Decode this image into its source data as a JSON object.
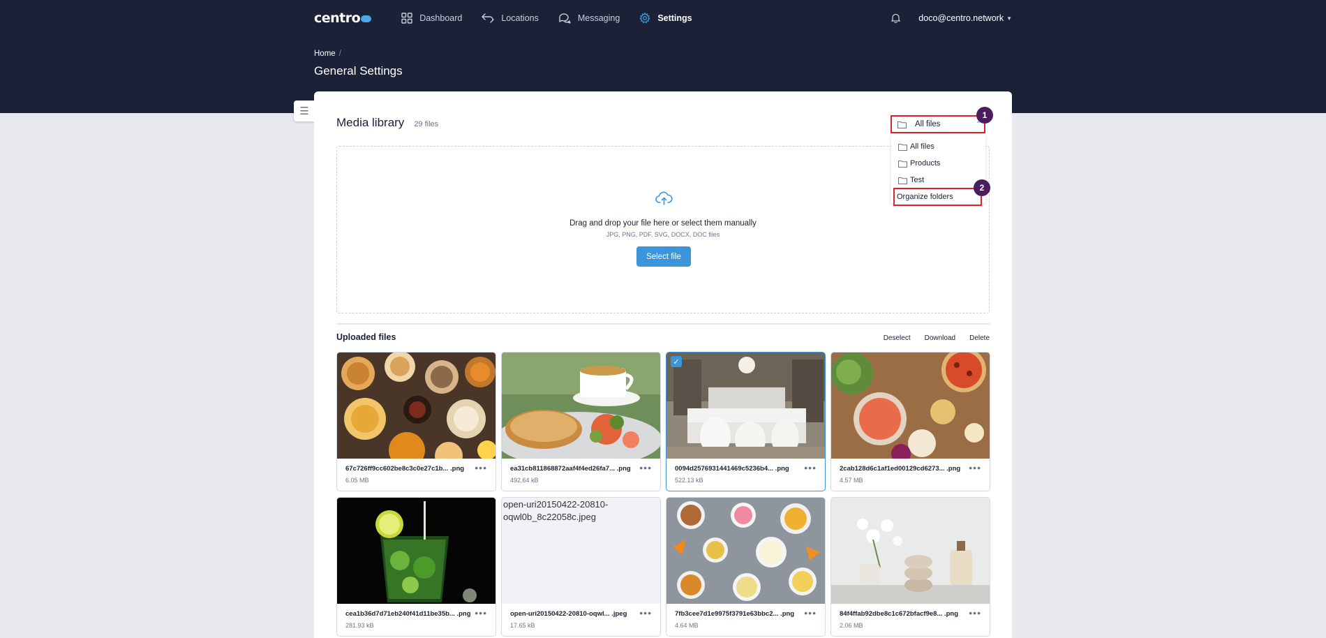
{
  "nav": {
    "logo_text": "centro",
    "items": [
      {
        "label": "Dashboard",
        "icon": "grid-icon"
      },
      {
        "label": "Locations",
        "icon": "arrows-icon"
      },
      {
        "label": "Messaging",
        "icon": "chat-icon"
      },
      {
        "label": "Settings",
        "icon": "gear-icon",
        "active": true
      }
    ],
    "user_email": "doco@centro.network"
  },
  "breadcrumb": {
    "home": "Home",
    "separator": "/"
  },
  "page_title": "General Settings",
  "media": {
    "title": "Media library",
    "file_count": "29 files",
    "folder_select": {
      "value": "All files"
    },
    "dropdown": {
      "items": [
        "All files",
        "Products",
        "Test"
      ],
      "organize": "Organize folders"
    },
    "badges": [
      "1",
      "2"
    ],
    "dropzone": {
      "text": "Drag and drop your file here or select them manually",
      "formats": "JPG, PNG, PDF, SVG, DOCX, DOC files",
      "button": "Select file"
    },
    "uploaded": {
      "title": "Uploaded files",
      "actions": {
        "deselect": "Deselect",
        "download": "Download",
        "delete": "Delete"
      },
      "files": [
        {
          "name": "67c726ff9cc602be8c3c0e27c1b... .png",
          "size": "6.05 MB"
        },
        {
          "name": "ea31cb811868872aaf4f4ed26fa7... .png",
          "size": "492.64 kB"
        },
        {
          "name": "0094d2576931441469c5236b4... .png",
          "size": "522.13 kB",
          "selected": true
        },
        {
          "name": "2cab128d6c1af1ed00129cd6273... .png",
          "size": "4.57 MB"
        },
        {
          "name": "cea1b36d7d71eb240f41d11be35b... .png",
          "size": "281.93 kB"
        },
        {
          "name": "open-uri20150422-20810-oqwl... .jpeg",
          "size": "17.65 kB",
          "broken_alt": "open-uri20150422-20810-oqwl0b_8c22058c.jpeg"
        },
        {
          "name": "7fb3cee7d1e9975f3791e63bbc2... .png",
          "size": "4.64 MB"
        },
        {
          "name": "84f4ffab92dbe8c1c672bfacf9e8... .png",
          "size": "2.06 MB"
        }
      ]
    }
  },
  "colors": {
    "header_bg": "#1b2238",
    "accent": "#3a95da",
    "highlight_red": "#e0202a",
    "badge": "#4a1d5e"
  }
}
